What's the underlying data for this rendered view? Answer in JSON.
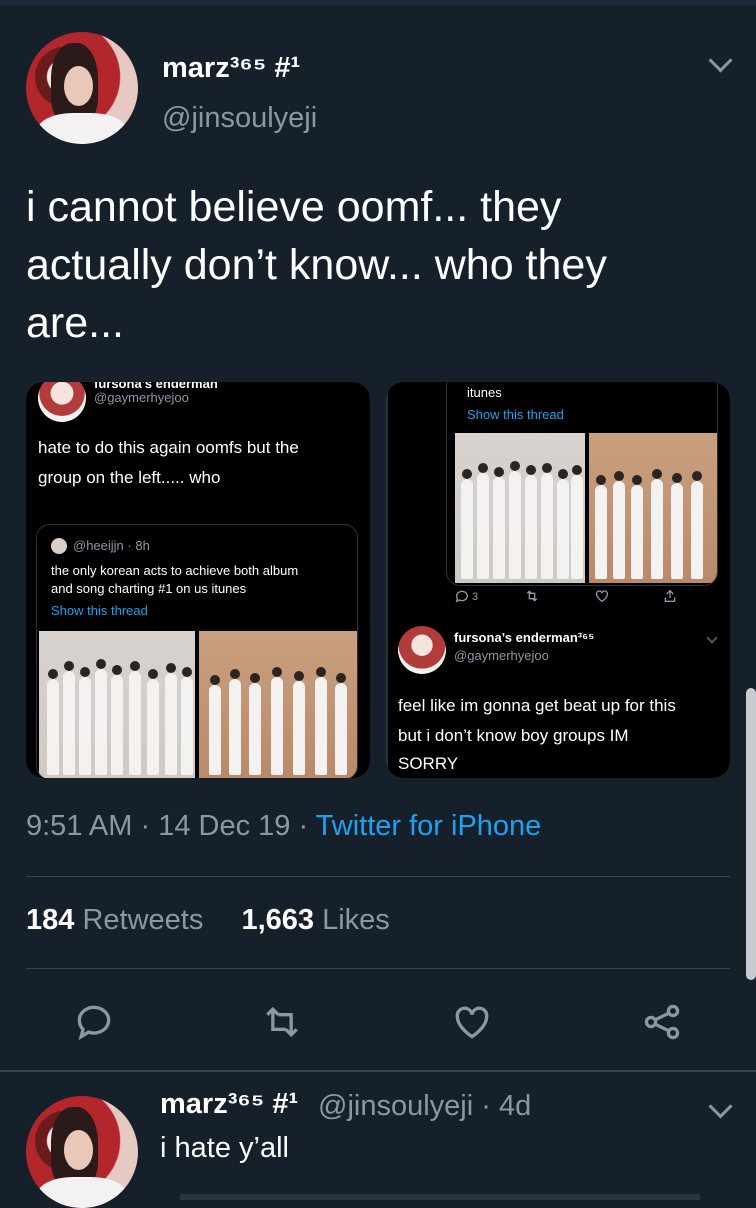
{
  "tweet": {
    "display_name": "marz³⁶⁵ #¹",
    "handle": "@jinsoulyeji",
    "text": "i cannot believe oomf... they actually don’t know... who they are...",
    "time": "9:51 AM",
    "date": "14 Dec 19",
    "source": "Twitter for iPhone",
    "retweets_count": "184",
    "retweets_label": "Retweets",
    "likes_count": "1,663",
    "likes_label": "Likes"
  },
  "embed_left": {
    "cut_name": "fursona’s enderman",
    "handle": "@gaymerhyejoo",
    "text_line1": "hate to do this again oomfs but the",
    "text_line2": "group on the left..... who",
    "quote": {
      "handle": "@heeijjn · 8h",
      "line1": "the only korean acts to achieve both album",
      "line2": "and song charting #1 on us itunes",
      "link": "Show this thread"
    }
  },
  "embed_right": {
    "top_text": "itunes",
    "link": "Show this thread",
    "reply_count": "3",
    "name": "fursona’s enderman³⁶⁵",
    "handle": "@gaymerhyejoo",
    "line1": "feel like im gonna get beat up for this",
    "line2": "but i don’t know boy groups IM",
    "line3": "SORRY"
  },
  "reply": {
    "display_name": "marz³⁶⁵ #¹",
    "handle_time": "@jinsoulyeji · 4d",
    "text": "i hate y’all"
  },
  "colors": {
    "background": "#15202b",
    "accent": "#1da1f2",
    "muted": "#8899a6",
    "divider": "#38444d"
  },
  "icons": [
    "reply-icon",
    "retweet-icon",
    "like-icon",
    "share-icon",
    "chevron-down-icon"
  ]
}
